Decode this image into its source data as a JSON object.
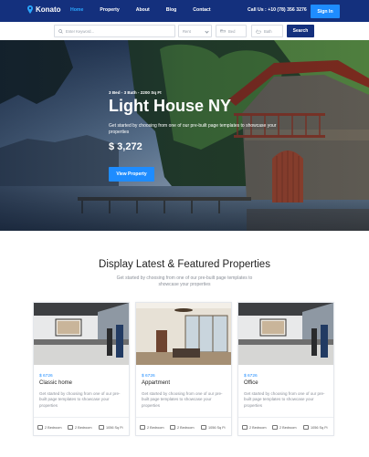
{
  "nav": {
    "logo": "Konato",
    "links": [
      "Home",
      "Property",
      "About",
      "Blog",
      "Contact"
    ],
    "call": "Call Us : +10 (78) 356 3276",
    "signin": "Sign In"
  },
  "search": {
    "keyword_placeholder": "Enter Keyword...",
    "type_value": "Rent",
    "beds_value": "Bed",
    "bath_value": "Bath",
    "button": "Search"
  },
  "hero": {
    "meta": "3 Bed - 3 Bath - 2200 Sq Ft",
    "title": "Light House NY",
    "description": "Get started by choosing from one of our pre-built page templates to showcase your properties",
    "price": "$ 3,272",
    "button": "View Property"
  },
  "section": {
    "title": "Display Latest & Featured Properties",
    "subtitle": "Get started by choosing from one of our pre-built page templates to showcase your properties"
  },
  "cards": [
    {
      "price": "$ 6726",
      "title": "Classic home",
      "description": "Get started by choosing from one of our pre-built page templates to showcase your properties",
      "bedrooms": "2 Bedroom",
      "bathrooms": "2 Bedroom",
      "area": "1056 Sq Ft"
    },
    {
      "price": "$ 6726",
      "title": "Appartment",
      "description": "Get started by choosing from one of our pre-built page templates to showcase your properties",
      "bedrooms": "2 Bedroom",
      "bathrooms": "2 Bedroom",
      "area": "1056 Sq Ft"
    },
    {
      "price": "$ 6726",
      "title": "Office",
      "description": "Get started by choosing from one of our pre-built page templates to showcase your properties",
      "bedrooms": "2 Bedroom",
      "bathrooms": "2 Bedroom",
      "area": "1056 Sq Ft"
    }
  ],
  "colors": {
    "nav_bg": "#14307d",
    "accent": "#1e8cff",
    "price": "#1e8cff"
  }
}
